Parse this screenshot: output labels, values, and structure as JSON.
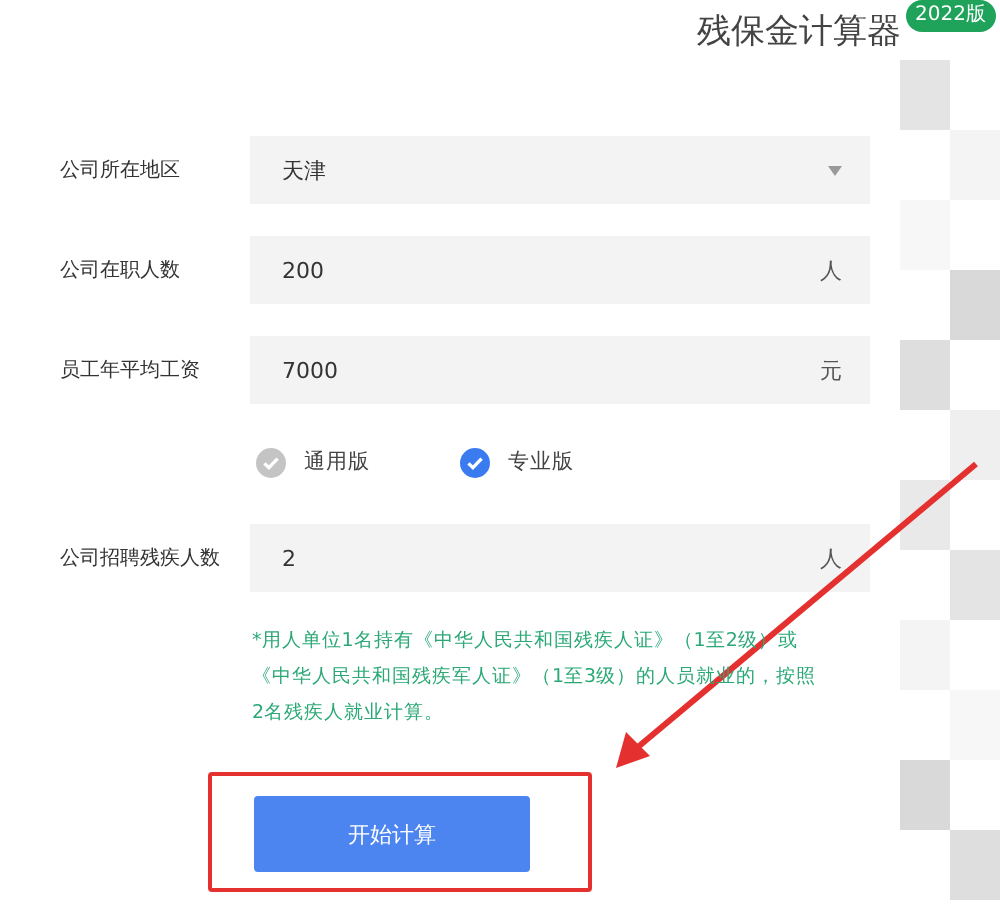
{
  "header": {
    "title": "残保金计算器",
    "badge": "2022版"
  },
  "fields": [
    {
      "kind": "select",
      "label": "公司所在地区",
      "value": "天津"
    },
    {
      "kind": "input",
      "label": "公司在职人数",
      "value": "200",
      "unit": "人"
    },
    {
      "kind": "input",
      "label": "员工年平均工资",
      "value": "7000",
      "unit": "元"
    }
  ],
  "versions": [
    {
      "label": "通用版",
      "selected": false
    },
    {
      "label": "专业版",
      "selected": true
    }
  ],
  "hires_field": {
    "label": "公司招聘残疾人数",
    "value": "2",
    "unit": "人"
  },
  "note": "*用人单位1名持有《中华人民共和国残疾人证》（1至2级）或《中华人民共和国残疾军人证》（1至3级）的人员就业的，按照2名残疾人就业计算。",
  "button": "开始计算"
}
